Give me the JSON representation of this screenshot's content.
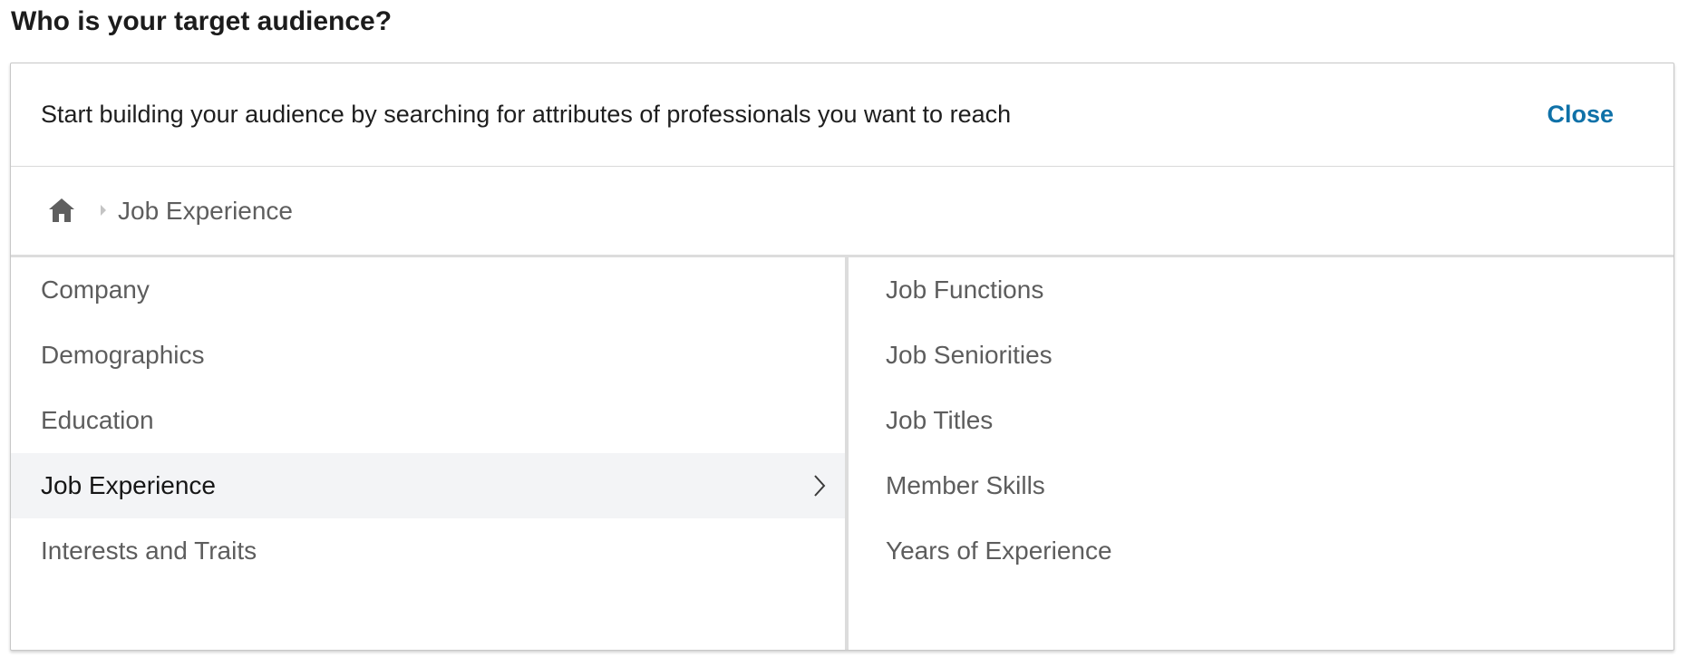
{
  "page": {
    "title": "Who is your target audience?"
  },
  "panel": {
    "instructions": "Start building your audience by searching for attributes of professionals you want to reach",
    "close_label": "Close"
  },
  "breadcrumb": {
    "home_icon": "home-icon",
    "separator_icon": "caret-right-icon",
    "current": "Job Experience"
  },
  "categories": [
    {
      "label": "Company",
      "selected": false
    },
    {
      "label": "Demographics",
      "selected": false
    },
    {
      "label": "Education",
      "selected": false
    },
    {
      "label": "Job Experience",
      "selected": true
    },
    {
      "label": "Interests and Traits",
      "selected": false
    }
  ],
  "subcategories": [
    {
      "label": "Job Functions"
    },
    {
      "label": "Job Seniorities"
    },
    {
      "label": "Job Titles"
    },
    {
      "label": "Member Skills"
    },
    {
      "label": "Years of Experience"
    }
  ],
  "colors": {
    "link": "#0f71a8",
    "selected_row_bg": "#f3f4f6",
    "muted_text": "#5d5d5d"
  }
}
